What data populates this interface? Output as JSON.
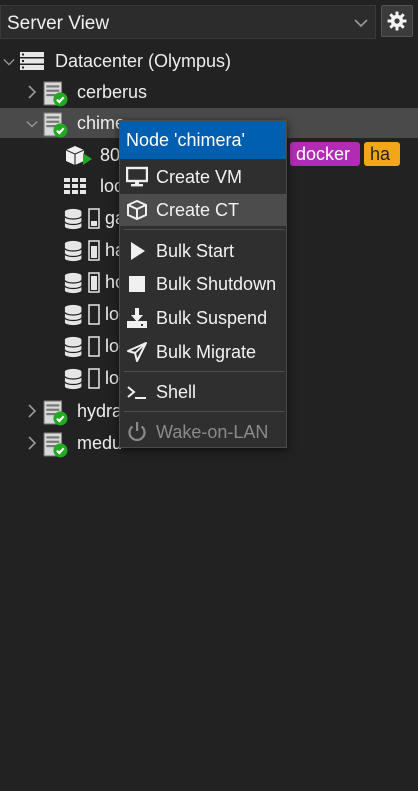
{
  "header": {
    "view_label": "Server View"
  },
  "tree": {
    "datacenter": "Datacenter (Olympus)",
    "nodes": [
      {
        "label": "cerberus"
      },
      {
        "label": "chime"
      },
      {
        "label": "hydra"
      },
      {
        "label": "medu"
      }
    ],
    "children": [
      {
        "label": "80",
        "icon": "container-running-icon"
      },
      {
        "label": "loc",
        "icon": "sdn-zone-icon"
      },
      {
        "label": "ga",
        "icon": "storage-icon"
      },
      {
        "label": "ha",
        "icon": "storage-icon"
      },
      {
        "label": "ho",
        "icon": "storage-icon"
      },
      {
        "label": "lo",
        "icon": "storage-icon"
      },
      {
        "label": "lo",
        "icon": "storage-icon"
      },
      {
        "label": "lo",
        "icon": "storage-icon"
      }
    ],
    "tags": [
      "docker",
      "ha"
    ]
  },
  "context_menu": {
    "title": "Node 'chimera'",
    "items": [
      {
        "label": "Create VM",
        "icon": "monitor-icon"
      },
      {
        "label": "Create CT",
        "icon": "cube-icon"
      },
      {
        "label": "Bulk Start",
        "icon": "play-icon"
      },
      {
        "label": "Bulk Shutdown",
        "icon": "stop-icon"
      },
      {
        "label": "Bulk Suspend",
        "icon": "download-icon"
      },
      {
        "label": "Bulk Migrate",
        "icon": "paper-plane-icon"
      },
      {
        "label": "Shell",
        "icon": "terminal-icon"
      },
      {
        "label": "Wake-on-LAN",
        "icon": "power-icon"
      }
    ]
  },
  "colors": {
    "background": "#222222",
    "menu_header": "#005fb0",
    "status_ok": "#22aa22",
    "tag_docker": "#b22bb3",
    "tag_ha": "#f0a818"
  }
}
